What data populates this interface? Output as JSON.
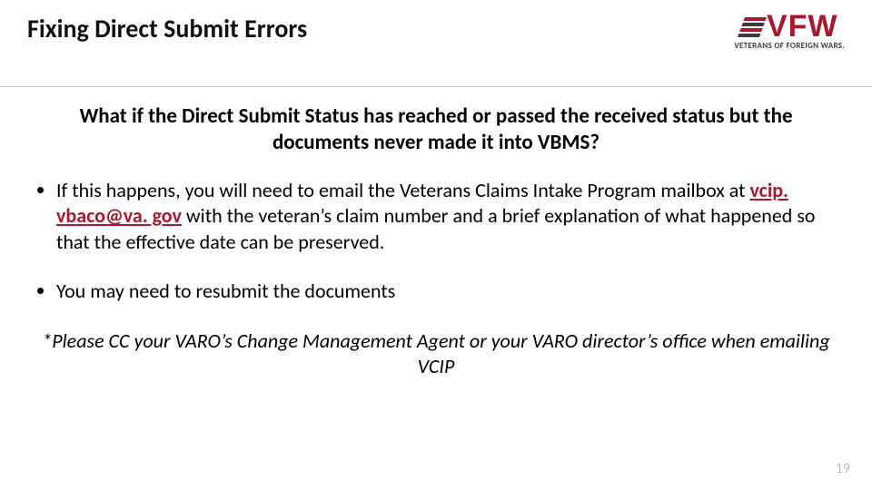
{
  "header": {
    "title": "Fixing Direct Submit Errors",
    "logo_text": "VFW",
    "logo_sub": "VETERANS OF FOREIGN WARS.",
    "brand_color": "#a6192e"
  },
  "question": "What if the Direct Submit Status has reached or passed the received status but the documents never made it into VBMS?",
  "bullets": {
    "b1_pre": "If this happens, you will need to email the Veterans Claims Intake Program mailbox at ",
    "b1_email": "vcip. vbaco@va. gov",
    "b1_post": " with the veteran’s claim number and a brief explanation of what happened so that the effective date can be preserved.",
    "b2": "You may need to resubmit the documents"
  },
  "note": "*Please CC your VARO’s Change Management Agent or your VARO director’s office when emailing VCIP",
  "page_number": "19"
}
